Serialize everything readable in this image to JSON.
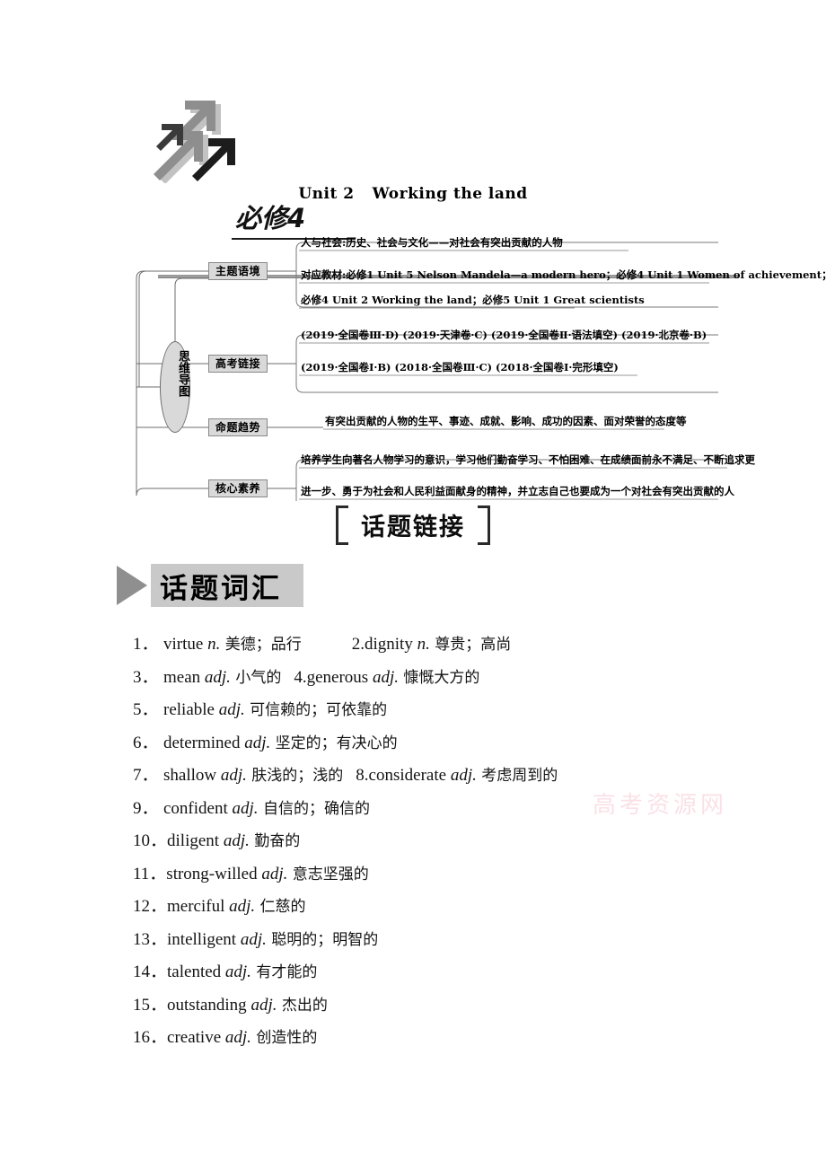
{
  "header": {
    "banner_title": "必修4",
    "unit_number": "Unit 2",
    "unit_name": "Working the land"
  },
  "mindmap": {
    "center_label": "思维导图",
    "branches": [
      {
        "label": "主题语境",
        "lines": [
          "人与社会:历史、社会与文化——对社会有突出贡献的人物",
          "对应教材:必修1  Unit 5 Nelson Mandela—a modern hero；必修4 Unit 1 Women of achievement；",
          "必修4 Unit 2 Working the land；必修5 Unit 1 Great scientists"
        ]
      },
      {
        "label": "高考链接",
        "lines": [
          "(2019·全国卷Ⅲ·D) (2019·天津卷·C) (2019·全国卷Ⅱ·语法填空) (2019·北京卷·B)",
          "(2019·全国卷Ⅰ·B) (2018·全国卷Ⅲ·C) (2018·全国卷Ⅰ·完形填空)"
        ]
      },
      {
        "label": "命题趋势",
        "lines": [
          "有突出贡献的人物的生平、事迹、成就、影响、成功的因素、面对荣誉的态度等"
        ]
      },
      {
        "label": "核心素养",
        "lines": [
          "培养学生向著名人物学习的意识，学习他们勤奋学习、不怕困难、在成绩面前永不满足、不断追求更",
          "进一步、勇于为社会和人民利益面献身的精神，并立志自己也要成为一个对社会有突出贡献的人"
        ]
      }
    ]
  },
  "topic_link_title": "话题链接",
  "section_title": "话题词汇",
  "vocabulary": [
    {
      "num": "1．",
      "word": "virtue",
      "pos": "n.",
      "cn": "美德；品行",
      "num2": "2.",
      "word2": "dignity",
      "pos2": "n.",
      "cn2": "尊贵；高尚",
      "gap": "wide"
    },
    {
      "num": "3．",
      "word": "mean",
      "pos": "adj.",
      "cn": "小气的",
      "num2": "4.",
      "word2": "generous",
      "pos2": "adj.",
      "cn2": "慷慨大方的",
      "gap": "narrow"
    },
    {
      "num": "5．",
      "word": "reliable",
      "pos": "adj.",
      "cn": "可信赖的；可依靠的"
    },
    {
      "num": "6．",
      "word": "determined",
      "pos": "adj.",
      "cn": "坚定的；有决心的"
    },
    {
      "num": "7．",
      "word": "shallow",
      "pos": "adj.",
      "cn": "肤浅的；浅的",
      "num2": "8.",
      "word2": "considerate",
      "pos2": "adj.",
      "cn2": "考虑周到的",
      "gap": "narrow"
    },
    {
      "num": "9．",
      "word": "confident",
      "pos": "adj.",
      "cn": "自信的；确信的"
    },
    {
      "num": "10．",
      "word": "diligent",
      "pos": "adj.",
      "cn": "勤奋的"
    },
    {
      "num": "11．",
      "word": "strong-willed",
      "pos": "adj.",
      "cn": "意志坚强的"
    },
    {
      "num": "12．",
      "word": "merciful",
      "pos": "adj.",
      "cn": "仁慈的"
    },
    {
      "num": "13．",
      "word": "intelligent",
      "pos": "adj.",
      "cn": "聪明的；明智的"
    },
    {
      "num": "14．",
      "word": "talented",
      "pos": "adj.",
      "cn": "有才能的"
    },
    {
      "num": "15．",
      "word": "outstanding",
      "pos": "adj.",
      "cn": "杰出的"
    },
    {
      "num": "16．",
      "word": "creative",
      "pos": "adj.",
      "cn": "创造性的"
    }
  ],
  "watermark": "高考资源网",
  "colors": {
    "node_fill": "#d9d9d9",
    "band_fill": "#c9c9c9",
    "line": "#6d6d6d",
    "watermark": "#f6c9d4"
  }
}
